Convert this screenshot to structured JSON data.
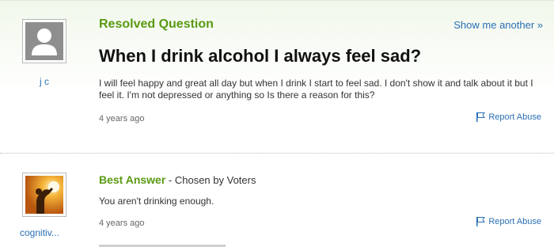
{
  "question": {
    "status_label": "Resolved Question",
    "show_another": "Show me another »",
    "title": "When I drink alcohol I always feel sad?",
    "body": "I will feel happy and great all day but when I drink I start to feel sad. I don't show it and talk about it but I feel it. I'm not depressed or anything so Is there a reason for this?",
    "time_ago": "4 years ago",
    "report_label": "Report Abuse",
    "asker": {
      "name": "j c",
      "avatar_icon": "default-user-silhouette-icon"
    }
  },
  "answer": {
    "label": "Best Answer",
    "chosen_by": " - Chosen by Voters",
    "body": "You aren't drinking enough.",
    "time_ago": "4 years ago",
    "report_label": "Report Abuse",
    "answerer": {
      "name": "cognitiv...",
      "avatar_icon": "person-holding-light-icon"
    }
  },
  "colors": {
    "title_green": "#5a9a13",
    "link_blue": "#2a6fb5",
    "panel_tint": "#f2f8ec"
  }
}
